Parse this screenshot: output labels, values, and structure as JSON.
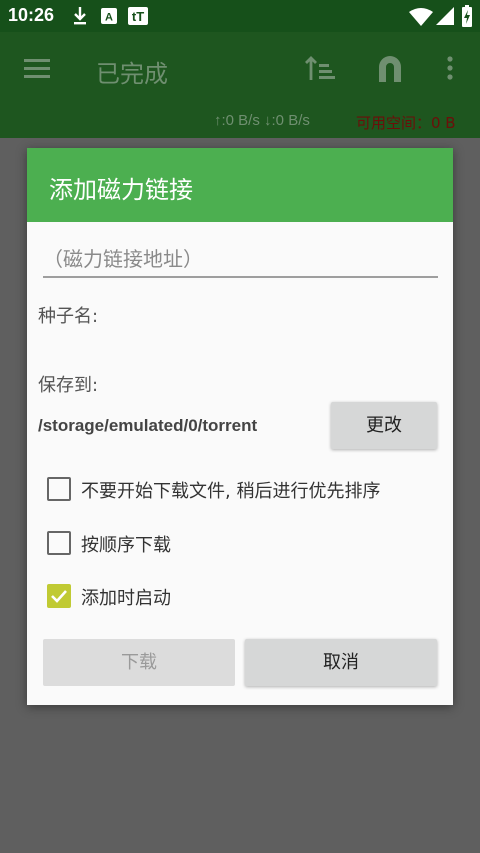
{
  "status_bar": {
    "time": "10:26",
    "icons": [
      "download-icon",
      "a-notification-icon",
      "tt-notification-icon",
      "wifi-icon",
      "signal-icon",
      "battery-charging-icon"
    ]
  },
  "app_bar": {
    "title": "已完成",
    "speed": "↑:0 B/s ↓:0 B/s",
    "free_space": "可用空间：0 B",
    "icons": [
      "menu-icon",
      "sort-icon",
      "magnet-icon",
      "more-vert-icon"
    ]
  },
  "dialog": {
    "title": "添加磁力链接",
    "magnet_placeholder": "（磁力链接地址）",
    "magnet_value": "",
    "torrent_name_label": "种子名:",
    "save_to_label": "保存到:",
    "save_path": "/storage/emulated/0/torrent",
    "change_button": "更改",
    "options": [
      {
        "label": "不要开始下载文件, 稍后进行优先排序",
        "checked": false
      },
      {
        "label": "按顺序下载",
        "checked": false
      },
      {
        "label": "添加时启动",
        "checked": true
      }
    ],
    "download_button": "下载",
    "cancel_button": "取消"
  },
  "colors": {
    "status_bar": "#16501a",
    "app_bar": "#1e561f",
    "dialog_header": "#4caf50",
    "checkbox_checked": "#c0ca33"
  }
}
